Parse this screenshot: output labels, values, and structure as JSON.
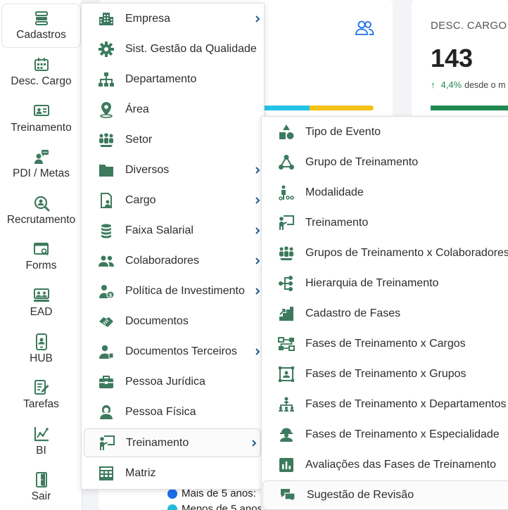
{
  "sidebar": {
    "items": [
      {
        "label": "Cadastros",
        "icon": "cadastros-icon"
      },
      {
        "label": "Desc. Cargo",
        "icon": "desc-cargo-icon"
      },
      {
        "label": "Treinamento",
        "icon": "treinamento-icon"
      },
      {
        "label": "PDI / Metas",
        "icon": "pdi-metas-icon"
      },
      {
        "label": "Recrutamento",
        "icon": "recrutamento-icon"
      },
      {
        "label": "Forms",
        "icon": "forms-icon"
      },
      {
        "label": "EAD",
        "icon": "ead-icon"
      },
      {
        "label": "HUB",
        "icon": "hub-icon"
      },
      {
        "label": "Tarefas",
        "icon": "tarefas-icon"
      },
      {
        "label": "BI",
        "icon": "bi-icon"
      },
      {
        "label": "Sair",
        "icon": "sair-icon"
      }
    ]
  },
  "menu_cadastros": {
    "items": [
      {
        "label": "Empresa",
        "has_submenu": true
      },
      {
        "label": "Sist. Gestão da Qualidade",
        "has_submenu": false
      },
      {
        "label": "Departamento",
        "has_submenu": false
      },
      {
        "label": "Área",
        "has_submenu": false
      },
      {
        "label": "Setor",
        "has_submenu": false
      },
      {
        "label": "Diversos",
        "has_submenu": true
      },
      {
        "label": "Cargo",
        "has_submenu": true
      },
      {
        "label": "Faixa Salarial",
        "has_submenu": true
      },
      {
        "label": "Colaboradores",
        "has_submenu": true
      },
      {
        "label": "Política de Investimento",
        "has_submenu": true
      },
      {
        "label": "Documentos",
        "has_submenu": false
      },
      {
        "label": "Documentos Terceiros",
        "has_submenu": true
      },
      {
        "label": "Pessoa Jurídica",
        "has_submenu": false
      },
      {
        "label": "Pessoa Física",
        "has_submenu": false
      },
      {
        "label": "Treinamento",
        "has_submenu": true,
        "selected": true
      },
      {
        "label": "Matriz",
        "has_submenu": false
      }
    ]
  },
  "menu_treinamento": {
    "items": [
      {
        "label": "Tipo de Evento"
      },
      {
        "label": "Grupo de Treinamento"
      },
      {
        "label": "Modalidade"
      },
      {
        "label": "Treinamento"
      },
      {
        "label": "Grupos de Treinamento x Colaboradores"
      },
      {
        "label": "Hierarquia de Treinamento"
      },
      {
        "label": "Cadastro de Fases"
      },
      {
        "label": "Fases de Treinamento x Cargos"
      },
      {
        "label": "Fases de Treinamento x Grupos"
      },
      {
        "label": "Fases de Treinamento x Departamentos"
      },
      {
        "label": "Fases de Treinamento x Especialidade"
      },
      {
        "label": "Avaliações das Fases de Treinamento"
      },
      {
        "label": "Sugestão de Revisão"
      }
    ]
  },
  "dashboard": {
    "kpi": {
      "title": "DESC. CARGO",
      "value": "143",
      "delta_arrow": "↑",
      "delta_pct": "4,4%",
      "delta_text": "desde o m"
    },
    "legend": [
      {
        "label": "Mais de 5 anos:",
        "color": "#1a6ee6"
      },
      {
        "label": "Menos de 5 anos",
        "color": "#22bcd8"
      }
    ],
    "bar_colors": [
      "#22c3e6",
      "#f5c116"
    ],
    "colors": {
      "icon_green": "#3d7a5e",
      "accent_blue": "#1a6ee6",
      "positive": "#1e8a4f"
    }
  }
}
